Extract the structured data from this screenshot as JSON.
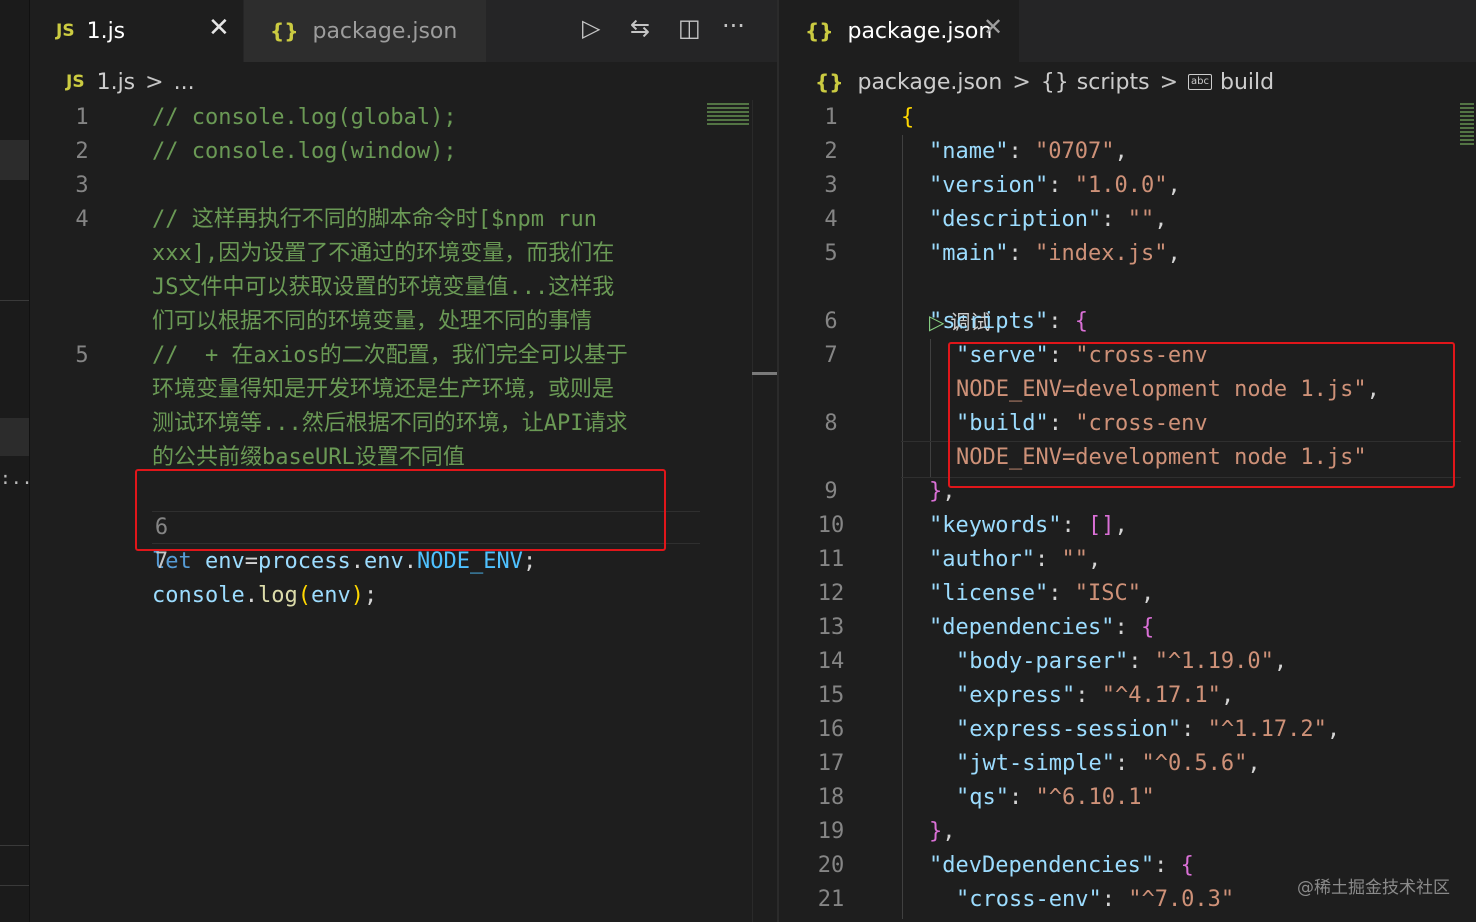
{
  "left_editor": {
    "tabs": [
      {
        "icon": "JS",
        "label": "1.js",
        "close": "✕"
      },
      {
        "icon": "{}",
        "label": "package.json"
      }
    ],
    "toolbar": {
      "run": "▷",
      "compare": "⇆",
      "split": "◫",
      "more": "···"
    },
    "breadcrumb": {
      "icon": "JS",
      "file": "1.js",
      "sep": ">",
      "more": "..."
    },
    "lines": [
      {
        "n": "1",
        "text": "// console.log(global);"
      },
      {
        "n": "2",
        "text": "// console.log(window);"
      },
      {
        "n": "3",
        "text": ""
      },
      {
        "n": "4",
        "text": "// 这样再执行不同的脚本命令时[$npm run"
      },
      {
        "n": "",
        "text": "xxx],因为设置了不通过的环境变量，而我们在"
      },
      {
        "n": "",
        "text": "JS文件中可以获取设置的环境变量值...这样我"
      },
      {
        "n": "",
        "text": "们可以根据不同的环境变量，处理不同的事情"
      },
      {
        "n": "5",
        "text": "//  + 在axios的二次配置，我们完全可以基于"
      },
      {
        "n": "",
        "text": "环境变量得知是开发环境还是生产环境，或则是"
      },
      {
        "n": "",
        "text": "测试环境等...然后根据不同的环境，让API请求"
      },
      {
        "n": "",
        "text": "的公共前缀baseURL设置不同值"
      }
    ],
    "line6": {
      "n": "6",
      "kw": "let",
      "var": "env",
      "eq": "=",
      "obj": "process",
      "dot1": ".",
      "prop": "env",
      "dot2": ".",
      "const": "NODE_ENV",
      "semi": ";"
    },
    "line7": {
      "n": "7",
      "obj": "console",
      "dot": ".",
      "fn": "log",
      "open": "(",
      "arg": "env",
      "close": ")",
      "semi": ";"
    }
  },
  "right_editor": {
    "tab": {
      "icon": "{}",
      "label": "package.json",
      "close": "✕"
    },
    "breadcrumb": {
      "icon": "{}",
      "file": "package.json",
      "sep": ">",
      "scripts_icon": "{}",
      "scripts": "scripts",
      "build_icon": "abc",
      "build": "build"
    },
    "codelens": {
      "icon": "▷",
      "label": "调试"
    },
    "lines": [
      {
        "n": "1",
        "parts": [
          [
            "b1",
            "{"
          ]
        ]
      },
      {
        "n": "2",
        "parts": [
          [
            "key",
            "\"name\""
          ],
          [
            "pl",
            ": "
          ],
          [
            "str",
            "\"0707\""
          ],
          [
            "pl",
            ","
          ]
        ]
      },
      {
        "n": "3",
        "parts": [
          [
            "key",
            "\"version\""
          ],
          [
            "pl",
            ": "
          ],
          [
            "str",
            "\"1.0.0\""
          ],
          [
            "pl",
            ","
          ]
        ]
      },
      {
        "n": "4",
        "parts": [
          [
            "key",
            "\"description\""
          ],
          [
            "pl",
            ": "
          ],
          [
            "str",
            "\"\""
          ],
          [
            "pl",
            ","
          ]
        ]
      },
      {
        "n": "5",
        "parts": [
          [
            "key",
            "\"main\""
          ],
          [
            "pl",
            ": "
          ],
          [
            "str",
            "\"index.js\""
          ],
          [
            "pl",
            ","
          ]
        ]
      },
      {
        "n": "6",
        "parts": [
          [
            "key",
            "\"scripts\""
          ],
          [
            "pl",
            ": "
          ],
          [
            "b2",
            "{"
          ]
        ]
      },
      {
        "n": "7",
        "parts": [
          [
            "key",
            "\"serve\""
          ],
          [
            "pl",
            ": "
          ],
          [
            "str",
            "\"cross-env"
          ]
        ]
      },
      {
        "n": "",
        "parts": [
          [
            "str",
            "NODE_ENV=development node 1.js\""
          ],
          [
            "pl",
            ","
          ]
        ]
      },
      {
        "n": "8",
        "parts": [
          [
            "key",
            "\"build\""
          ],
          [
            "pl",
            ": "
          ],
          [
            "str",
            "\"cross-env"
          ]
        ]
      },
      {
        "n": "",
        "parts": [
          [
            "str",
            "NODE_ENV=development node 1.js\""
          ]
        ]
      },
      {
        "n": "9",
        "parts": [
          [
            "b2",
            "}"
          ],
          [
            "pl",
            ","
          ]
        ]
      },
      {
        "n": "10",
        "parts": [
          [
            "key",
            "\"keywords\""
          ],
          [
            "pl",
            ": "
          ],
          [
            "b2",
            "[]"
          ],
          [
            "pl",
            ","
          ]
        ]
      },
      {
        "n": "11",
        "parts": [
          [
            "key",
            "\"author\""
          ],
          [
            "pl",
            ": "
          ],
          [
            "str",
            "\"\""
          ],
          [
            "pl",
            ","
          ]
        ]
      },
      {
        "n": "12",
        "parts": [
          [
            "key",
            "\"license\""
          ],
          [
            "pl",
            ": "
          ],
          [
            "str",
            "\"ISC\""
          ],
          [
            "pl",
            ","
          ]
        ]
      },
      {
        "n": "13",
        "parts": [
          [
            "key",
            "\"dependencies\""
          ],
          [
            "pl",
            ": "
          ],
          [
            "b2",
            "{"
          ]
        ]
      },
      {
        "n": "14",
        "parts": [
          [
            "key",
            "\"body-parser\""
          ],
          [
            "pl",
            ": "
          ],
          [
            "str",
            "\"^1.19.0\""
          ],
          [
            "pl",
            ","
          ]
        ]
      },
      {
        "n": "15",
        "parts": [
          [
            "key",
            "\"express\""
          ],
          [
            "pl",
            ": "
          ],
          [
            "str",
            "\"^4.17.1\""
          ],
          [
            "pl",
            ","
          ]
        ]
      },
      {
        "n": "16",
        "parts": [
          [
            "key",
            "\"express-session\""
          ],
          [
            "pl",
            ": "
          ],
          [
            "str",
            "\"^1.17.2\""
          ],
          [
            "pl",
            ","
          ]
        ]
      },
      {
        "n": "17",
        "parts": [
          [
            "key",
            "\"jwt-simple\""
          ],
          [
            "pl",
            ": "
          ],
          [
            "str",
            "\"^0.5.6\""
          ],
          [
            "pl",
            ","
          ]
        ]
      },
      {
        "n": "18",
        "parts": [
          [
            "key",
            "\"qs\""
          ],
          [
            "pl",
            ": "
          ],
          [
            "str",
            "\"^6.10.1\""
          ]
        ]
      },
      {
        "n": "19",
        "parts": [
          [
            "b2",
            "}"
          ],
          [
            "pl",
            ","
          ]
        ]
      },
      {
        "n": "20",
        "parts": [
          [
            "key",
            "\"devDependencies\""
          ],
          [
            "pl",
            ": "
          ],
          [
            "b2",
            "{"
          ]
        ]
      },
      {
        "n": "21",
        "parts": [
          [
            "key",
            "\"cross-env\""
          ],
          [
            "pl",
            ": "
          ],
          [
            "str",
            "\"^7.0.3\""
          ]
        ]
      }
    ]
  },
  "watermark": "@稀土掘金技术社区",
  "colors": {
    "highlight_box": "#e0161a",
    "comment": "#6a9955",
    "keyword": "#569cd6",
    "string": "#ce9178",
    "json_key": "#9cdcfe"
  }
}
